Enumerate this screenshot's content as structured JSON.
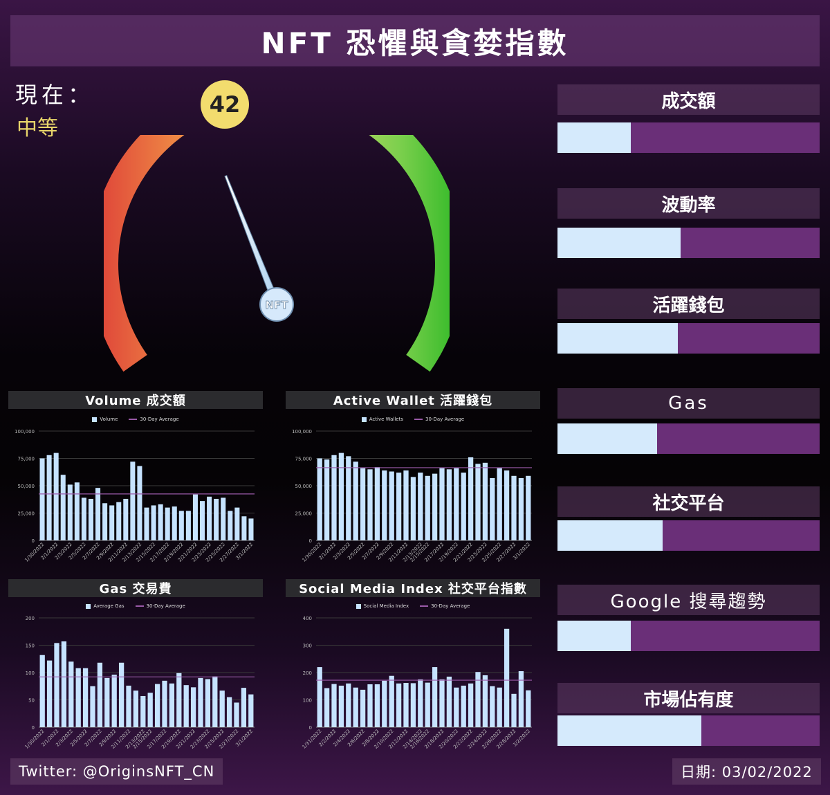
{
  "title": "NFT 恐懼與貪婪指數",
  "current": {
    "label": "現在：",
    "level": "中等",
    "score": "42",
    "gauge_value": 42,
    "gauge_max": 100
  },
  "gauge": {
    "hub_label": "NFT"
  },
  "metrics": [
    {
      "label": "成交額",
      "value": 0.28
    },
    {
      "label": "波動率",
      "value": 0.47
    },
    {
      "label": "活躍錢包",
      "value": 0.46
    },
    {
      "label": "Gas",
      "value": 0.38
    },
    {
      "label": "社交平台",
      "value": 0.4
    },
    {
      "label": "Google 搜尋趨勢",
      "value": 0.28
    },
    {
      "label": "市場佔有度",
      "value": 0.55
    }
  ],
  "footer": {
    "twitter": "Twitter: @OriginsNFT_CN",
    "date": "日期: 03/02/2022"
  },
  "colors": {
    "bar": "#c6e3ff",
    "avg_line": "#9a5aa8",
    "metric_track": "#6a2f78",
    "metric_fill": "#d5eafc",
    "badge": "#f2dc6e"
  },
  "chart_data": [
    {
      "type": "bar",
      "title": "Volume 成交額",
      "legend": [
        "Volume",
        "30-Day Average"
      ],
      "ylim": [
        0,
        100000
      ],
      "yticks": [
        "0",
        "25,000",
        "50,000",
        "75,000",
        "100,000"
      ],
      "ytick_values": [
        0,
        25000,
        50000,
        75000,
        100000
      ],
      "xtick_labels": [
        "1/30/2022",
        "2/1/2022",
        "2/3/2022",
        "2/5/2022",
        "2/7/2022",
        "2/9/2022",
        "2/11/2022",
        "2/13/2022",
        "2/15/2022",
        "2/17/2022",
        "2/19/2022",
        "2/21/2022",
        "2/23/2022",
        "2/25/2022",
        "2/27/2022",
        "3/1/2022"
      ],
      "values": [
        75000,
        78000,
        80000,
        60000,
        51000,
        53000,
        39000,
        38000,
        48000,
        34000,
        32000,
        35000,
        38000,
        72000,
        68000,
        30000,
        32000,
        33000,
        30000,
        31000,
        27000,
        27000,
        42000,
        36000,
        40000,
        38000,
        39000,
        27000,
        30000,
        22000,
        20000
      ],
      "average": 42500
    },
    {
      "type": "bar",
      "title": "Active Wallet 活躍錢包",
      "legend": [
        "Active Wallets",
        "30-Day Average"
      ],
      "ylim": [
        0,
        100000
      ],
      "yticks": [
        "0",
        "25,000",
        "50,000",
        "75,000",
        "100,000"
      ],
      "ytick_values": [
        0,
        25000,
        50000,
        75000,
        100000
      ],
      "xtick_labels": [
        "1/30/2022",
        "2/1/2022",
        "2/3/2022",
        "2/5/2022",
        "2/7/2022",
        "2/9/2022",
        "2/11/2022",
        "2/13/2022",
        "2/15/2022",
        "2/17/2022",
        "2/19/2022",
        "2/21/2022",
        "2/23/2022",
        "2/25/2022",
        "2/27/2022",
        "3/1/2022"
      ],
      "values": [
        75000,
        74000,
        78000,
        80000,
        77000,
        72000,
        66000,
        65000,
        67000,
        64000,
        63000,
        62000,
        64000,
        58000,
        62000,
        59000,
        61000,
        66000,
        65000,
        66000,
        62000,
        76000,
        70000,
        71000,
        57000,
        66000,
        64000,
        59000,
        57000,
        59000
      ],
      "average": 66500
    },
    {
      "type": "bar",
      "title": "Gas 交易費",
      "legend": [
        "Average Gas",
        "30-Day Average"
      ],
      "ylim": [
        0,
        200
      ],
      "yticks": [
        "0",
        "50",
        "100",
        "150",
        "200"
      ],
      "ytick_values": [
        0,
        50,
        100,
        150,
        200
      ],
      "xtick_labels": [
        "1/30/2022",
        "2/1/2022",
        "2/3/2022",
        "2/5/2022",
        "2/7/2022",
        "2/9/2022",
        "2/11/2022",
        "2/13/2022",
        "2/15/2022",
        "2/17/2022",
        "2/19/2022",
        "2/21/2022",
        "2/23/2022",
        "2/25/2022",
        "2/27/2022",
        "3/1/2022"
      ],
      "values": [
        132,
        122,
        154,
        157,
        120,
        108,
        108,
        75,
        118,
        90,
        96,
        118,
        76,
        67,
        57,
        63,
        79,
        85,
        80,
        99,
        77,
        73,
        90,
        88,
        93,
        67,
        55,
        45,
        72,
        60
      ],
      "average": 92
    },
    {
      "type": "bar",
      "title": "Social Media Index 社交平台指數",
      "legend": [
        "Social Media Index",
        "30-Day Average"
      ],
      "ylim": [
        0,
        400
      ],
      "yticks": [
        "0",
        "100",
        "200",
        "300",
        "400"
      ],
      "ytick_values": [
        0,
        100,
        200,
        300,
        400
      ],
      "xtick_labels": [
        "1/31/2022",
        "2/2/2022",
        "2/4/2022",
        "2/6/2022",
        "2/8/2022",
        "2/10/2022",
        "2/12/2022",
        "2/14/2022",
        "2/16/2022",
        "2/18/2022",
        "2/20/2022",
        "2/22/2022",
        "2/24/2022",
        "2/26/2022",
        "2/28/2022",
        "3/2/2022"
      ],
      "values": [
        220,
        143,
        158,
        152,
        160,
        145,
        137,
        157,
        157,
        170,
        188,
        160,
        162,
        161,
        175,
        163,
        220,
        175,
        185,
        145,
        152,
        160,
        202,
        190,
        150,
        145,
        360,
        122,
        205,
        135
      ],
      "average": 172
    }
  ]
}
